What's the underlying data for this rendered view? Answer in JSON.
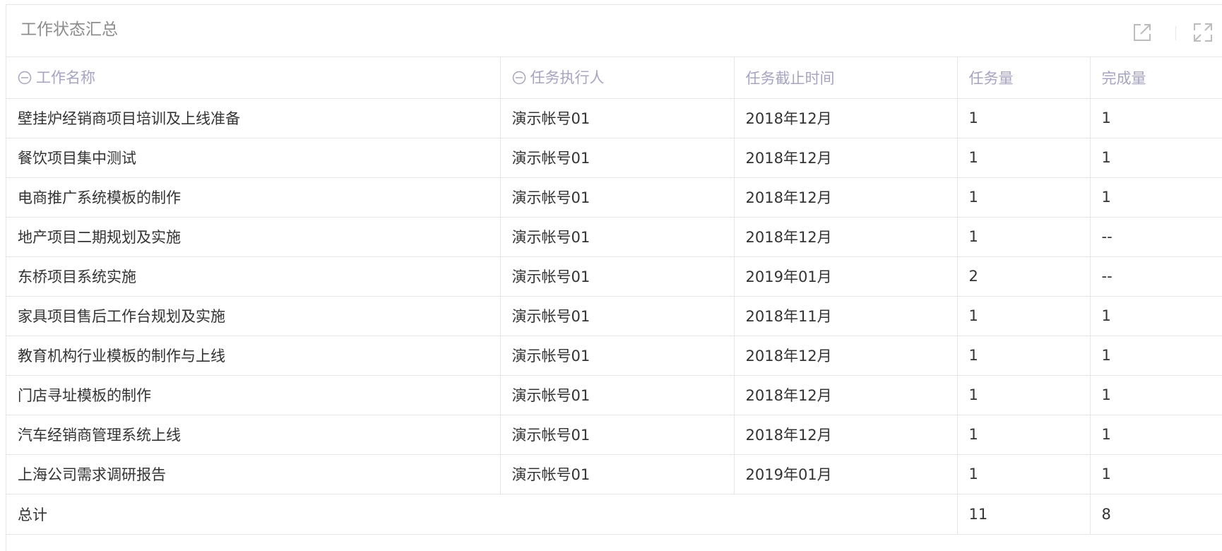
{
  "panel": {
    "title": "工作状态汇总",
    "tools": [
      {
        "icon": "external-link-icon"
      },
      {
        "icon": "fullscreen-icon"
      }
    ]
  },
  "table": {
    "columns": [
      {
        "label": "工作名称",
        "collapsible": true
      },
      {
        "label": "任务执行人",
        "collapsible": true
      },
      {
        "label": "任务截止时间",
        "collapsible": false
      },
      {
        "label": "任务量",
        "collapsible": false
      },
      {
        "label": "完成量",
        "collapsible": false
      }
    ],
    "rows": [
      [
        "壁挂炉经销商项目培训及上线准备",
        "演示帐号01",
        "2018年12月",
        "1",
        "1"
      ],
      [
        "餐饮项目集中测试",
        "演示帐号01",
        "2018年12月",
        "1",
        "1"
      ],
      [
        "电商推广系统模板的制作",
        "演示帐号01",
        "2018年12月",
        "1",
        "1"
      ],
      [
        "地产项目二期规划及实施",
        "演示帐号01",
        "2018年12月",
        "1",
        "--"
      ],
      [
        "东桥项目系统实施",
        "演示帐号01",
        "2019年01月",
        "2",
        "--"
      ],
      [
        "家具项目售后工作台规划及实施",
        "演示帐号01",
        "2018年11月",
        "1",
        "1"
      ],
      [
        "教育机构行业模板的制作与上线",
        "演示帐号01",
        "2018年12月",
        "1",
        "1"
      ],
      [
        "门店寻址模板的制作",
        "演示帐号01",
        "2018年12月",
        "1",
        "1"
      ],
      [
        "汽车经销商管理系统上线",
        "演示帐号01",
        "2018年12月",
        "1",
        "1"
      ],
      [
        "上海公司需求调研报告",
        "演示帐号01",
        "2019年01月",
        "1",
        "1"
      ]
    ],
    "total": {
      "label": "总计",
      "task_count": "11",
      "completed_count": "8"
    }
  },
  "colors": {
    "header_text": "#a7a4c4",
    "title_text": "#8c8c8c",
    "border": "#e6e6e6",
    "body_text": "#333333"
  }
}
